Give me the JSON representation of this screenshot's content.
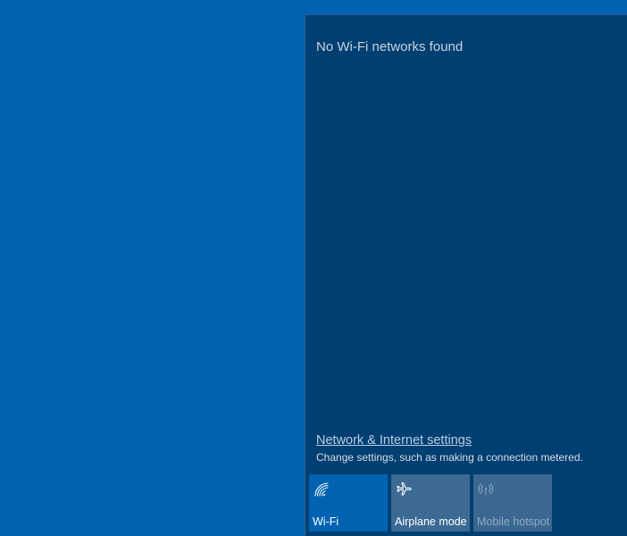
{
  "flyout": {
    "status_text": "No Wi-Fi networks found",
    "settings_link": "Network & Internet settings",
    "settings_description": "Change settings, such as making a connection metered."
  },
  "quick_actions": {
    "wifi": {
      "label": "Wi-Fi",
      "icon": "wifi-icon",
      "active": true
    },
    "airplane": {
      "label": "Airplane mode",
      "icon": "airplane-icon",
      "active": false
    },
    "hotspot": {
      "label": "Mobile hotspot",
      "icon": "hotspot-icon",
      "active": false,
      "disabled": true
    }
  },
  "colors": {
    "desktop": "#0063b1",
    "flyout_bg": "#003f72",
    "active_tile": "#0063b1",
    "inactive_tile": "#3c6a93"
  }
}
